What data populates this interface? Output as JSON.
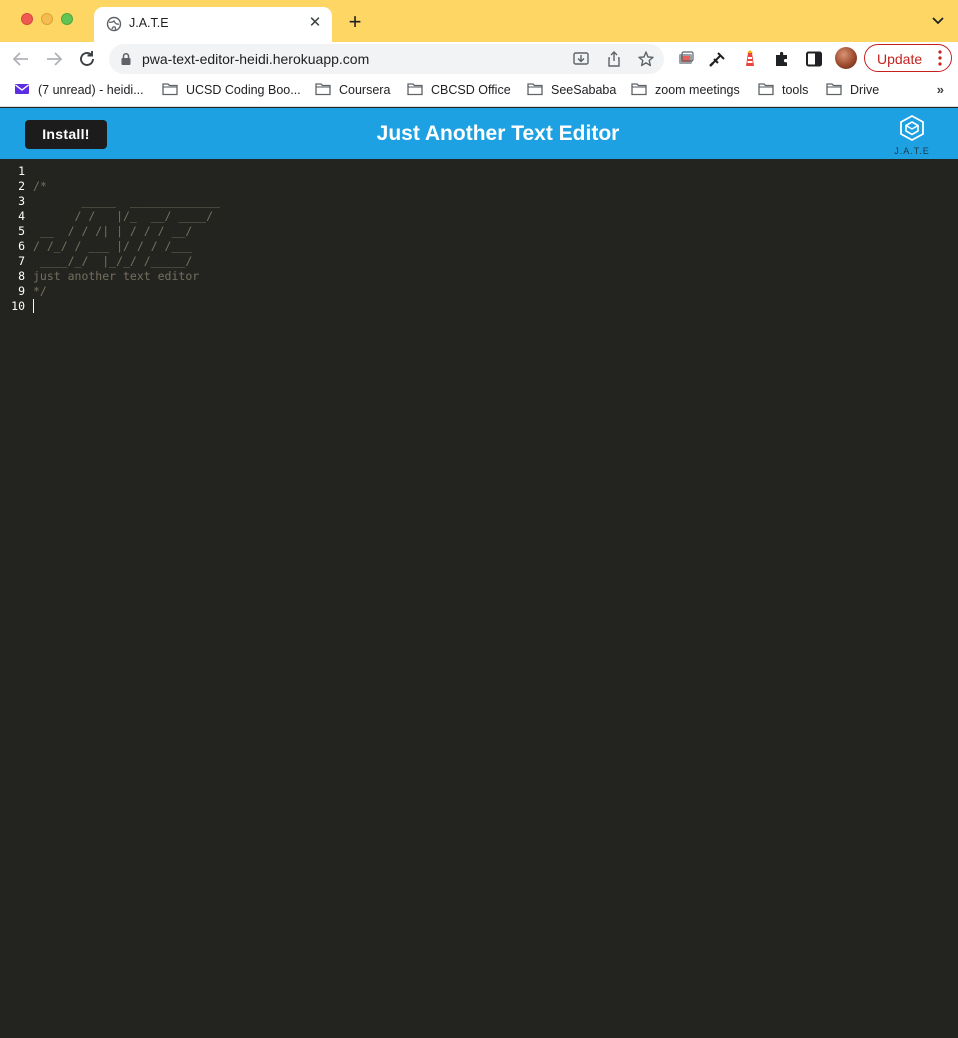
{
  "browser": {
    "tab_title": "J.A.T.E",
    "url": "pwa-text-editor-heidi.herokuapp.com",
    "update_label": "Update"
  },
  "bookmarks": [
    {
      "label": "(7 unread) - heidi...",
      "icon": "mail-icon"
    },
    {
      "label": "UCSD Coding Boo...",
      "icon": "folder-icon"
    },
    {
      "label": "Coursera",
      "icon": "folder-icon"
    },
    {
      "label": "CBCSD Office",
      "icon": "folder-icon"
    },
    {
      "label": "SeeSababa",
      "icon": "folder-icon"
    },
    {
      "label": "zoom meetings",
      "icon": "folder-icon"
    },
    {
      "label": "tools",
      "icon": "folder-icon"
    },
    {
      "label": "Drive",
      "icon": "folder-icon"
    }
  ],
  "app": {
    "install_label": "Install!",
    "title": "Just Another Text Editor",
    "logo_text": "J.A.T.E",
    "header_color": "#1da1e2"
  },
  "editor": {
    "line_numbers": [
      "1",
      "2",
      "3",
      "4",
      "5",
      "6",
      "7",
      "8",
      "9",
      "10"
    ],
    "lines": [
      "",
      "/*",
      "       _____  _____________",
      "      / /   |/_  __/ ____/",
      " __  / / /| | / / / __/",
      "/ /_/ / ___ |/ / / /___",
      " ____/_/  |_/_/ /_____/",
      "just another text editor",
      "*/",
      ""
    ],
    "comment_color": "#75715e",
    "background": "#232320"
  }
}
